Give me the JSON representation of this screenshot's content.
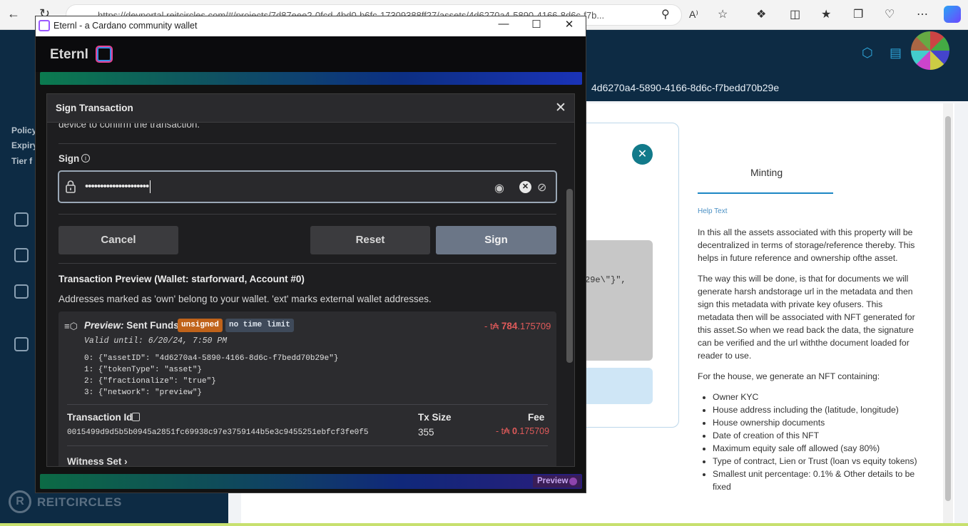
{
  "browser": {
    "url": "https://devportal.reitcircles.com/#/projects/7d87eee2-0fcd-4bd0-b6fc-17309388ff27/assets/4d6270a4-5890-4166-8d6c-f7b...",
    "reading_zoom": "A⁾"
  },
  "background_app": {
    "breadcrumb_id": "4d6270a4-5890-4166-8d6c-f7bedd70b29e",
    "sidebar_labels": [
      "Policy",
      "Expiry",
      "Tier f"
    ],
    "brand_name": "REITCIRCLES",
    "tab_label": "Minting",
    "help_title": "Help Text",
    "help_paragraphs": [
      "In this all the assets associated with this property will be decentralized in terms of storage/reference thereby. This helps in future reference and ownership ofthe asset.",
      "The way this will be done, is that for documents we will generate harsh andstorage url in the metadata and then sign this metadata with private key ofusers. This metadata then will be associated with NFT generated for this asset.So when we read back the data, the signature can be verified and the url withthe document loaded for reader to use.",
      "For the house, we generate an NFT containing:"
    ],
    "help_list": [
      "Owner KYC",
      "House address including the (latitude, longitude)",
      "House ownership documents",
      "Date of creation of this NFT",
      "Maximum equity sale off allowed (say 80%)",
      "Type of contract, Lien or Trust (loan vs equity tokens)",
      "Smallest unit percentage: 0.1% & Other details to be fixed"
    ],
    "code_fragment": "29e\\\"}\","
  },
  "window": {
    "title": "Eternl - a Cardano community wallet",
    "minimize": "—",
    "maximize": "☐",
    "close": "✕"
  },
  "eternl": {
    "logo_text": "Eternl",
    "preview_badge": "Preview"
  },
  "dialog": {
    "title": "Sign Transaction",
    "close": "✕",
    "cut_text": "device to confirm the transaction.",
    "sign_label": "Sign",
    "info": "i",
    "password_dots": "•••••••••••••••••••••",
    "cancel_label": "Cancel",
    "reset_label": "Reset",
    "sign_button_label": "Sign",
    "preview_title": "Transaction Preview (Wallet: starforward, Account #0)",
    "preview_sub": "Addresses marked as 'own' belong to your wallet. 'ext' marks external wallet addresses.",
    "card": {
      "heading_prefix": "Preview:",
      "heading": "Sent Funds",
      "tag_unsigned": "unsigned",
      "tag_no_time_limit": "no time limit",
      "amount_prefix": "- t₳",
      "amount_int": "784",
      "amount_dec": ".175709",
      "valid_until": "Valid until: 6/20/24, 7:50 PM",
      "metadata": [
        "0: {\"assetID\": \"4d6270a4-5890-4166-8d6c-f7bedd70b29e\"}",
        "1: {\"tokenType\": \"asset\"}",
        "2: {\"fractionalize\": \"true\"}",
        "3: {\"network\": \"preview\"}"
      ],
      "txid_label": "Transaction Id",
      "txid": "0015499d9d5b5b0945a2851fc69938c97e3759144b5e3c9455251ebfcf3fe0f5",
      "txsize_label": "Tx Size",
      "txsize": "355",
      "fee_label": "Fee",
      "fee_prefix": "- t₳",
      "fee_int": "0",
      "fee_dec": ".175709",
      "witness_label": "Witness Set"
    }
  }
}
